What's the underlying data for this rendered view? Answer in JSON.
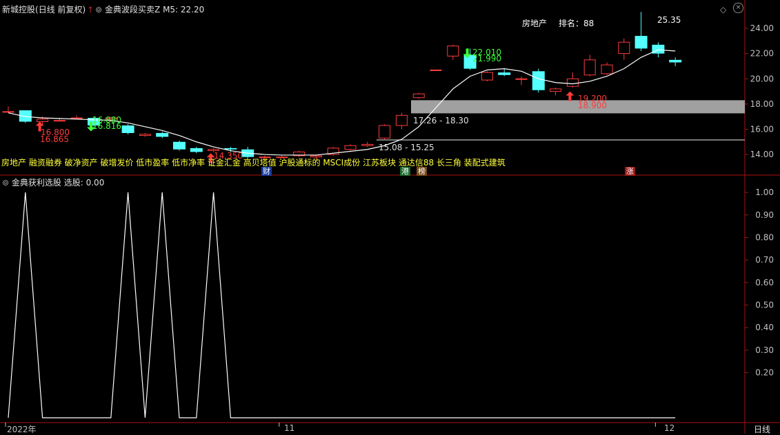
{
  "upper_panel": {
    "stock_name": "新城控股",
    "period_label": "(日线 前复权)",
    "indicator_name": "金典波段买卖Z",
    "ma_label": "M5:",
    "ma_value": "22.20",
    "sector": "房地产",
    "rank_label": "排名：",
    "rank_value": "88",
    "concepts": "房地产 融资融券 破净资产 破增发价 低市盈率 低市净率 证金汇金 高贝塔值 沪股通标的 MSCI成份 江苏板块 通达信88 长三角 装配式建筑",
    "markers": [
      "财",
      "港",
      "榜",
      "涨"
    ],
    "price_labels": {
      "high": "25.35",
      "buy_low_1": "16.800",
      "buy_low_2": "16.865",
      "sell_1": "16.880",
      "sell_1b": "16.816",
      "buy_2": "14.350",
      "sell_2a": "22.010",
      "sell_2b": "21.990",
      "buy_3a": "19.200",
      "buy_3b": "18.900",
      "zone_upper": "17.26 - 18.30",
      "zone_lower": "15.08 - 15.25"
    }
  },
  "lower_panel": {
    "indicator_name": "金典获利选股",
    "select_label": "选股:",
    "select_value": "0.00"
  },
  "x_axis": {
    "labels": [
      "2022年",
      "11",
      "12"
    ],
    "period_button": "日线"
  },
  "colors": {
    "up": "#ff3b3b",
    "down": "#54ffff",
    "ma": "#ffffff",
    "zone": "#a0a0a0",
    "concept_text": "#ffff3a",
    "axis_border": "#b01010",
    "sell_text": "#3cff3c",
    "buy_text": "#ff3b3b"
  },
  "chart_data": [
    {
      "type": "candlestick",
      "title": "新城控股 (日线 前复权)",
      "y_ticks": [
        14.0,
        16.0,
        18.0,
        20.0,
        22.0,
        24.0
      ],
      "ylim": [
        12.8,
        25.7
      ],
      "candles": [
        {
          "open": 17.4,
          "close": 17.4,
          "high": 17.8,
          "low": 17.3
        },
        {
          "open": 17.5,
          "close": 16.6,
          "high": 17.5,
          "low": 16.5
        },
        {
          "open": 16.6,
          "close": 16.8,
          "high": 17.0,
          "low": 16.3
        },
        {
          "open": 16.7,
          "close": 16.7,
          "high": 16.9,
          "low": 16.6
        },
        {
          "open": 16.9,
          "close": 16.9,
          "high": 17.1,
          "low": 16.8
        },
        {
          "open": 16.9,
          "close": 16.3,
          "high": 17.0,
          "low": 16.2
        },
        {
          "open": 16.8,
          "close": 16.9,
          "high": 17.0,
          "low": 16.6
        },
        {
          "open": 16.3,
          "close": 15.7,
          "high": 16.4,
          "low": 15.6
        },
        {
          "open": 15.5,
          "close": 15.6,
          "high": 15.7,
          "low": 15.4
        },
        {
          "open": 15.7,
          "close": 15.4,
          "high": 15.8,
          "low": 15.3
        },
        {
          "open": 15.0,
          "close": 14.4,
          "high": 15.1,
          "low": 14.3
        },
        {
          "open": 14.5,
          "close": 14.2,
          "high": 14.6,
          "low": 14.1
        },
        {
          "open": 14.3,
          "close": 14.4,
          "high": 14.5,
          "low": 14.2
        },
        {
          "open": 14.5,
          "close": 14.4,
          "high": 14.6,
          "low": 14.2
        },
        {
          "open": 14.4,
          "close": 13.8,
          "high": 14.6,
          "low": 13.7
        },
        {
          "open": 13.8,
          "close": 13.8,
          "high": 13.9,
          "low": 13.6
        },
        {
          "open": 13.8,
          "close": 13.8,
          "high": 13.9,
          "low": 13.7
        },
        {
          "open": 13.9,
          "close": 14.2,
          "high": 14.3,
          "low": 13.8
        },
        {
          "open": 13.8,
          "close": 13.9,
          "high": 14.0,
          "low": 13.6
        },
        {
          "open": 14.0,
          "close": 14.5,
          "high": 14.6,
          "low": 13.9
        },
        {
          "open": 14.4,
          "close": 14.7,
          "high": 14.8,
          "low": 14.3
        },
        {
          "open": 14.7,
          "close": 14.8,
          "high": 15.0,
          "low": 14.6
        },
        {
          "open": 15.3,
          "close": 16.3,
          "high": 16.4,
          "low": 15.2
        },
        {
          "open": 16.3,
          "close": 17.1,
          "high": 17.3,
          "low": 16.0
        },
        {
          "open": 18.5,
          "close": 18.8,
          "high": 18.9,
          "low": 18.4
        },
        {
          "open": 20.7,
          "close": 20.7,
          "high": 20.7,
          "low": 20.7
        },
        {
          "open": 21.8,
          "close": 22.6,
          "high": 22.7,
          "low": 21.5
        },
        {
          "open": 21.9,
          "close": 20.8,
          "high": 22.4,
          "low": 20.7
        },
        {
          "open": 19.9,
          "close": 20.5,
          "high": 20.6,
          "low": 19.8
        },
        {
          "open": 20.5,
          "close": 20.3,
          "high": 20.8,
          "low": 20.2
        },
        {
          "open": 20.0,
          "close": 20.0,
          "high": 20.2,
          "low": 19.5
        },
        {
          "open": 20.6,
          "close": 19.1,
          "high": 20.8,
          "low": 18.9
        },
        {
          "open": 19.0,
          "close": 19.2,
          "high": 19.3,
          "low": 18.7
        },
        {
          "open": 19.4,
          "close": 20.0,
          "high": 20.5,
          "low": 19.3
        },
        {
          "open": 20.3,
          "close": 21.5,
          "high": 21.9,
          "low": 20.2
        },
        {
          "open": 20.4,
          "close": 21.1,
          "high": 21.3,
          "low": 20.3
        },
        {
          "open": 22.0,
          "close": 22.9,
          "high": 23.2,
          "low": 21.5
        },
        {
          "open": 23.4,
          "close": 22.4,
          "high": 25.3,
          "low": 22.2
        },
        {
          "open": 22.7,
          "close": 22.0,
          "high": 22.9,
          "low": 21.7
        },
        {
          "open": 21.5,
          "close": 21.3,
          "high": 21.7,
          "low": 21.0
        }
      ],
      "ma_series": {
        "name": "M5",
        "values": [
          17.3,
          17.0,
          16.9,
          16.85,
          16.8,
          16.75,
          16.7,
          16.5,
          16.2,
          15.9,
          15.5,
          15.0,
          14.6,
          14.3,
          14.1,
          14.0,
          13.95,
          13.95,
          13.95,
          14.1,
          14.25,
          14.4,
          14.7,
          15.2,
          16.2,
          17.7,
          19.2,
          20.2,
          20.7,
          20.8,
          20.6,
          20.0,
          19.7,
          19.6,
          19.8,
          20.2,
          20.8,
          21.7,
          22.3,
          22.2
        ]
      }
    },
    {
      "type": "line",
      "title": "金典获利选股",
      "y_ticks": [
        0.2,
        0.3,
        0.4,
        0.5,
        0.6,
        0.7,
        0.8,
        0.9,
        1.0
      ],
      "ylim": [
        0,
        1.04
      ],
      "x": [
        0,
        1,
        2,
        6,
        7,
        8,
        9,
        10,
        11,
        12,
        13,
        14,
        15,
        39
      ],
      "values": [
        0,
        1,
        0,
        0,
        1,
        0,
        1,
        0,
        0,
        1,
        0,
        0,
        0,
        0
      ]
    }
  ]
}
